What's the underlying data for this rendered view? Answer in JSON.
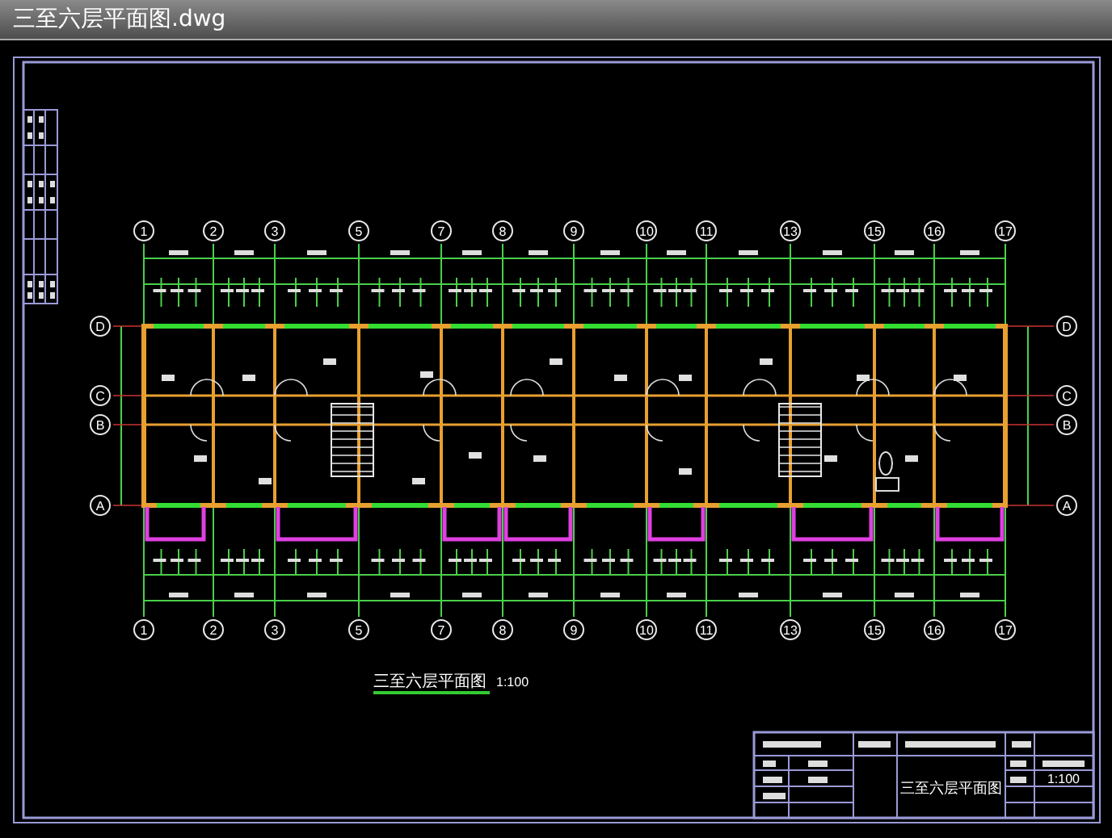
{
  "window": {
    "title": "三至六层平面图.dwg"
  },
  "plan": {
    "top_axes": [
      "1",
      "2",
      "3",
      "5",
      "7",
      "8",
      "9",
      "10",
      "11",
      "13",
      "15",
      "16",
      "17"
    ],
    "bottom_axes": [
      "1",
      "2",
      "3",
      "5",
      "7",
      "8",
      "9",
      "10",
      "11",
      "13",
      "15",
      "16",
      "17"
    ],
    "left_axes": [
      "D",
      "C",
      "B",
      "A"
    ],
    "right_axes": [
      "D",
      "C",
      "B",
      "A"
    ],
    "drawing_title": {
      "title": "三至六层平面图",
      "scale": "1:100"
    }
  },
  "title_block": {
    "drawing_name": "三至六层平面图",
    "scale": "1:100"
  }
}
